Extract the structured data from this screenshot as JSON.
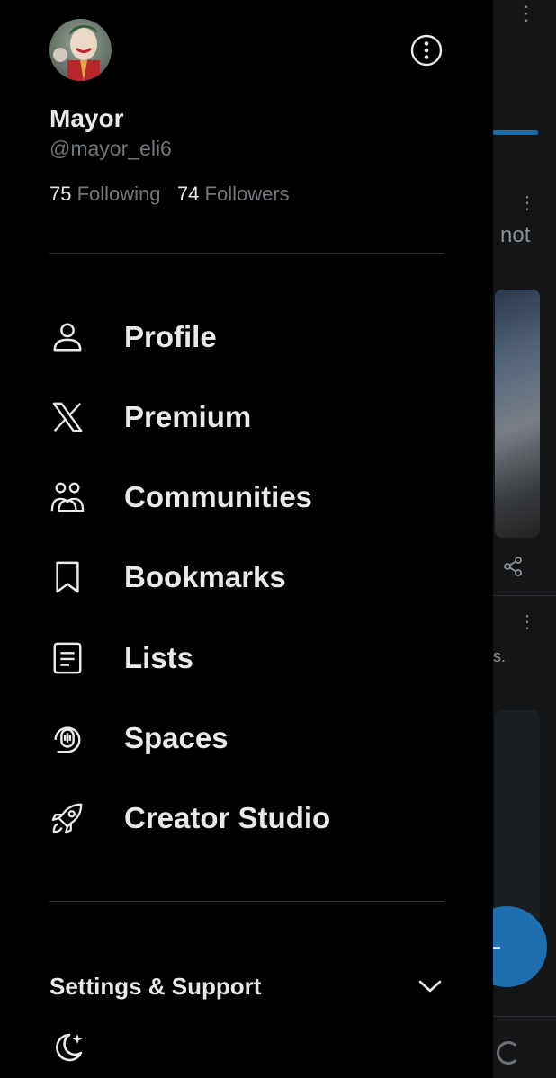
{
  "user": {
    "name": "Mayor",
    "handle": "@mayor_eli6",
    "following_count": "75",
    "following_label": "Following",
    "followers_count": "74",
    "followers_label": "Followers"
  },
  "menu": {
    "items": [
      {
        "label": "Profile",
        "icon": "person-icon"
      },
      {
        "label": "Premium",
        "icon": "x-logo-icon"
      },
      {
        "label": "Communities",
        "icon": "communities-icon"
      },
      {
        "label": "Bookmarks",
        "icon": "bookmark-icon"
      },
      {
        "label": "Lists",
        "icon": "list-icon"
      },
      {
        "label": "Spaces",
        "icon": "spaces-icon"
      },
      {
        "label": "Creator Studio",
        "icon": "rocket-icon"
      }
    ]
  },
  "settings": {
    "label": "Settings & Support"
  },
  "background": {
    "partial_word": "not",
    "partial_text": "s."
  },
  "colors": {
    "background": "#000000",
    "text": "#e7e9ea",
    "muted": "#71767b",
    "divider": "#2f3336",
    "accent": "#1d9bf0"
  }
}
